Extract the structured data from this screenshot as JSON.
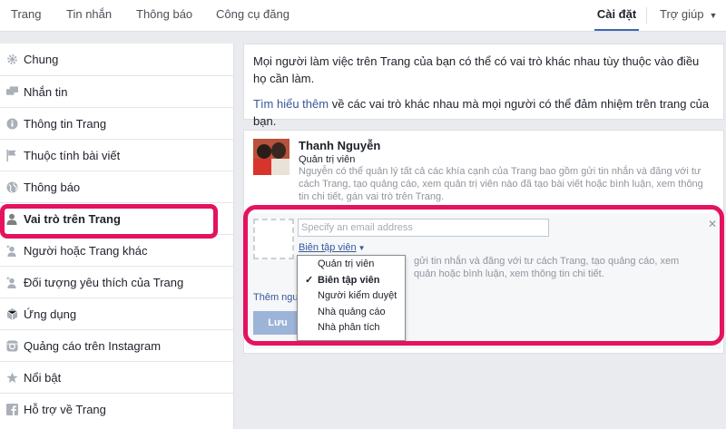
{
  "nav": {
    "tabs": [
      {
        "label": "Trang"
      },
      {
        "label": "Tin nhắn"
      },
      {
        "label": "Thông báo"
      },
      {
        "label": "Công cụ đăng"
      }
    ],
    "settings_label": "Cài đặt",
    "help_label": "Trợ giúp",
    "accent_color": "#4267b2"
  },
  "sidebar": {
    "items": [
      {
        "label": "Chung",
        "icon": "gear-icon"
      },
      {
        "label": "Nhắn tin",
        "icon": "message-icon"
      },
      {
        "label": "Thông tin Trang",
        "icon": "info-icon"
      },
      {
        "label": "Thuộc tính bài viết",
        "icon": "flag-icon"
      },
      {
        "label": "Thông báo",
        "icon": "globe-icon"
      },
      {
        "label": "Vai trò trên Trang",
        "icon": "person-icon"
      },
      {
        "label": "Người hoặc Trang khác",
        "icon": "person-plus-icon"
      },
      {
        "label": "Đối tượng yêu thích của Trang",
        "icon": "person-star-icon"
      },
      {
        "label": "Ứng dụng",
        "icon": "cube-icon"
      },
      {
        "label": "Quảng cáo trên Instagram",
        "icon": "instagram-icon"
      },
      {
        "label": "Nổi bật",
        "icon": "star-icon"
      },
      {
        "label": "Hỗ trợ về Trang",
        "icon": "facebook-icon"
      }
    ],
    "active_index": 5
  },
  "intro": {
    "text": "Mọi người làm việc trên Trang của bạn có thể có vai trò khác nhau tùy thuộc vào điều họ cần làm.",
    "link": "Tìm hiểu thêm",
    "link_suffix": " về các vai trò khác nhau mà mọi người có thể đảm nhiệm trên trang của bạn."
  },
  "existing_role": {
    "name": "Thanh Nguyễn",
    "role": "Quản trị viên",
    "description": "Nguyễn có thể quản lý tất cả các khía cạnh của Trang bao gồm gửi tin nhắn và đăng với tư cách Trang, tạo quảng cáo, xem quản trị viên nào đã tạo bài viết hoặc bình luận, xem thông tin chi tiết, gán vai trò trên Trang."
  },
  "add_role": {
    "email_placeholder": "Specify an email address",
    "selected_role": "Biên tập viên",
    "description_fragment": "gửi tin nhắn và đăng với tư cách Trang, tạo quảng cáo, xem quản hoặc bình luận, xem thông tin chi tiết.",
    "add_more_label": "Thêm người",
    "save_label": "Lưu"
  },
  "role_dropdown": {
    "options": [
      {
        "label": "Quản trị viên",
        "selected": false
      },
      {
        "label": "Biên tập viên",
        "selected": true
      },
      {
        "label": "Người kiểm duyệt",
        "selected": false
      },
      {
        "label": "Nhà quảng cáo",
        "selected": false
      },
      {
        "label": "Nhà phân tích",
        "selected": false
      }
    ]
  },
  "highlight_color": "#e4125f"
}
